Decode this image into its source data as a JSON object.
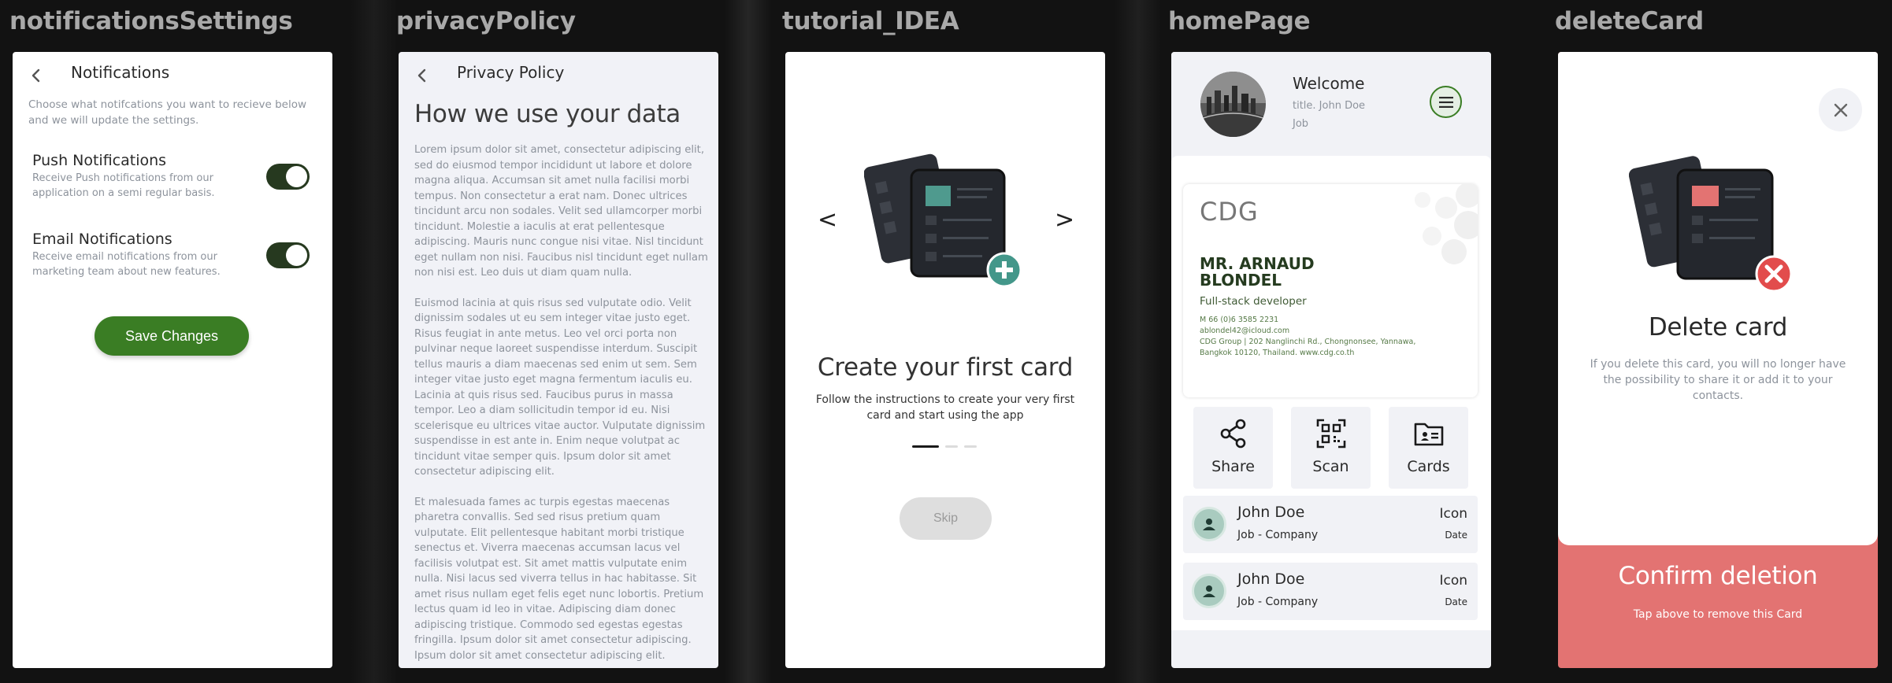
{
  "frames": {
    "notifications": "notificationsSettings",
    "privacy": "privacyPolicy",
    "tutorial": "tutorial_IDEA",
    "home": "homePage",
    "delete": "deleteCard"
  },
  "colors": {
    "accent_green": "#3a7d24",
    "toggle_on": "#26391f",
    "teal": "#43978a",
    "danger": "#e37372"
  },
  "icons": {
    "back": "chevron-left-icon",
    "prev": "chevron-left-icon",
    "next": "chevron-right-icon",
    "menu": "hamburger-icon",
    "share": "share-icon",
    "scan": "qr-scan-icon",
    "cards": "folder-card-icon",
    "person": "person-icon",
    "close": "close-icon",
    "add": "plus-circle-icon",
    "remove": "x-circle-icon"
  },
  "notifications": {
    "title": "Notifications",
    "intro": "Choose what notifcations you want to recieve below and we will update the settings.",
    "push": {
      "title": "Push Notifications",
      "desc": "Receive Push notifications from our application on a semi regular basis.",
      "enabled": true
    },
    "email": {
      "title": "Email Notifications",
      "desc": "Receive email notifications from our marketing team about new features.",
      "enabled": true
    },
    "save_label": "Save Changes"
  },
  "privacy": {
    "title": "Privacy Policy",
    "heading": "How we use your data",
    "paragraphs": [
      "Lorem ipsum dolor sit amet, consectetur adipiscing elit, sed do eiusmod tempor incididunt ut labore et dolore magna aliqua. Accumsan sit amet nulla facilisi morbi tempus. Non consectetur a erat nam. Donec ultrices tincidunt arcu non sodales. Velit sed ullamcorper morbi tincidunt. Molestie a iaculis at erat pellentesque adipiscing. Mauris nunc congue nisi vitae. Nisl tincidunt eget nullam non nisi. Faucibus nisl tincidunt eget nullam non nisi est. Leo duis ut diam quam nulla.",
      "Euismod lacinia at quis risus sed vulputate odio. Velit dignissim sodales ut eu sem integer vitae justo eget. Risus feugiat in ante metus. Leo vel orci porta non pulvinar neque laoreet suspendisse interdum. Suscipit tellus mauris a diam maecenas sed enim ut sem. Sem integer vitae justo eget magna fermentum iaculis eu. Lacinia at quis risus sed. Faucibus purus in massa tempor. Leo a diam sollicitudin tempor id eu. Nisi scelerisque eu ultrices vitae auctor. Vulputate dignissim suspendisse in est ante in. Enim neque volutpat ac tincidunt vitae semper quis. Ipsum dolor sit amet consectetur adipiscing elit.",
      "Et malesuada fames ac turpis egestas maecenas pharetra convallis. Sed sed risus pretium quam vulputate. Elit pellentesque habitant morbi tristique senectus et. Viverra maecenas accumsan lacus vel facilisis volutpat est. Sit amet mattis vulputate enim nulla. Nisi lacus sed viverra tellus in hac habitasse. Sit amet risus nullam eget felis eget nunc lobortis. Pretium lectus quam id leo in vitae. Adipiscing diam donec adipiscing tristique. Commodo sed egestas egestas fringilla. Ipsum dolor sit amet consectetur adipiscing. Ipsum dolor sit amet consectetur adipiscing elit."
    ]
  },
  "tutorial": {
    "prev": "<",
    "next": ">",
    "title": "Create your first card",
    "desc": "Follow the instructions to create your very first card and start using the app",
    "page_index": 1,
    "page_count": 3,
    "skip_label": "Skip"
  },
  "home": {
    "welcome": "Welcome",
    "user_title": "title. John Doe",
    "user_job": "Job",
    "card": {
      "logo": "CDG",
      "name": "MR. ARNAUD BLONDEL",
      "role": "Full-stack developer",
      "phone": "M 66 (0)6 3585 2231",
      "email": "ablondel42@icloud.com",
      "address1": "CDG Group | 202 Nanglinchi Rd., Chongnonsee, Yannawa,",
      "address2": "Bangkok 10120, Thailand. www.cdg.co.th"
    },
    "actions": [
      "Share",
      "Scan",
      "Cards"
    ],
    "contacts": [
      {
        "name": "John Doe",
        "job": "Job - Company",
        "icon": "Icon",
        "date": "Date"
      },
      {
        "name": "John Doe",
        "job": "Job - Company",
        "icon": "Icon",
        "date": "Date"
      }
    ]
  },
  "delete": {
    "title": "Delete card",
    "desc": "If you delete this card, you will no longer have the possibility to share it or add it to your contacts.",
    "confirm_title": "Confirm deletion",
    "confirm_sub": "Tap above to remove this Card"
  }
}
